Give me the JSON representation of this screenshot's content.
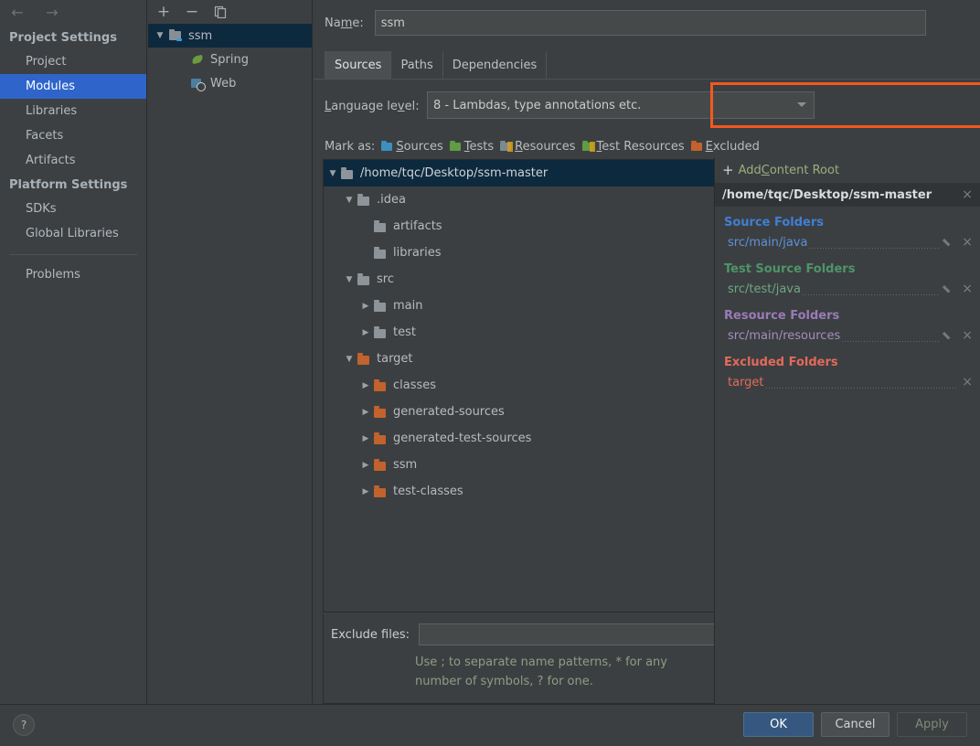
{
  "nav": {
    "back": "←",
    "forward": "→"
  },
  "sidebar": {
    "groups": [
      {
        "title": "Project Settings",
        "items": [
          {
            "label": "Project",
            "selected": false
          },
          {
            "label": "Modules",
            "selected": true
          },
          {
            "label": "Libraries",
            "selected": false
          },
          {
            "label": "Facets",
            "selected": false
          },
          {
            "label": "Artifacts",
            "selected": false
          }
        ]
      },
      {
        "title": "Platform Settings",
        "items": [
          {
            "label": "SDKs",
            "selected": false
          },
          {
            "label": "Global Libraries",
            "selected": false
          }
        ]
      }
    ],
    "problems": "Problems"
  },
  "modules_panel": {
    "toolbar": {
      "add": "+",
      "remove": "−",
      "copy": "copy-icon"
    },
    "tree": [
      {
        "label": "ssm",
        "icon": "module-icon",
        "twisty": "▼",
        "depth": 0,
        "selected": true
      },
      {
        "label": "Spring",
        "icon": "spring-leaf-icon",
        "twisty": "",
        "depth": 1,
        "selected": false
      },
      {
        "label": "Web",
        "icon": "web-icon",
        "twisty": "",
        "depth": 1,
        "selected": false
      }
    ]
  },
  "main": {
    "name_label_a": "Na",
    "name_label_u": "m",
    "name_label_b": "e:",
    "name_value": "ssm",
    "tabs": [
      {
        "label": "Sources",
        "active": true
      },
      {
        "label": "Paths",
        "active": false
      },
      {
        "label": "Dependencies",
        "active": false
      }
    ],
    "language_level": {
      "label_u": "L",
      "label_rest": "anguage le",
      "label_u2": "v",
      "label_end": "el:",
      "value": "8 - Lambdas, type annotations etc.",
      "highlight_color": "#f4581f"
    },
    "mark_as": {
      "label": "Mark as:",
      "options": [
        {
          "icon": "sources-folder-icon",
          "u": "S",
          "rest": "ources",
          "color": "#3d8fbd"
        },
        {
          "icon": "tests-folder-icon",
          "u": "T",
          "rest": "ests",
          "color": "#5f9c44"
        },
        {
          "icon": "resources-folder-icon",
          "u": "R",
          "rest": "esources",
          "color": "#7b8a92"
        },
        {
          "icon": "test-resources-folder-icon",
          "u": "T",
          "rest": "est Resources",
          "color": "#5f9c44"
        },
        {
          "icon": "excluded-folder-icon",
          "u": "E",
          "rest": "xcluded",
          "color": "#c2622c"
        }
      ]
    },
    "file_tree": [
      {
        "label": "/home/tqc/Desktop/ssm-master",
        "twisty": "▼",
        "indent": 0,
        "folder": "grey",
        "selected": true
      },
      {
        "label": ".idea",
        "twisty": "▼",
        "indent": 1,
        "folder": "grey",
        "selected": false
      },
      {
        "label": "artifacts",
        "twisty": "",
        "indent": 2,
        "folder": "grey",
        "selected": false
      },
      {
        "label": "libraries",
        "twisty": "",
        "indent": 2,
        "folder": "grey",
        "selected": false
      },
      {
        "label": "src",
        "twisty": "▼",
        "indent": 1,
        "folder": "grey",
        "selected": false
      },
      {
        "label": "main",
        "twisty": "▶",
        "indent": 2,
        "folder": "grey",
        "selected": false
      },
      {
        "label": "test",
        "twisty": "▶",
        "indent": 2,
        "folder": "grey",
        "selected": false
      },
      {
        "label": "target",
        "twisty": "▼",
        "indent": 1,
        "folder": "orange",
        "selected": false
      },
      {
        "label": "classes",
        "twisty": "▶",
        "indent": 2,
        "folder": "orange",
        "selected": false
      },
      {
        "label": "generated-sources",
        "twisty": "▶",
        "indent": 2,
        "folder": "orange",
        "selected": false
      },
      {
        "label": "generated-test-sources",
        "twisty": "▶",
        "indent": 2,
        "folder": "orange",
        "selected": false
      },
      {
        "label": "ssm",
        "twisty": "▶",
        "indent": 2,
        "folder": "orange",
        "selected": false
      },
      {
        "label": "test-classes",
        "twisty": "▶",
        "indent": 2,
        "folder": "orange",
        "selected": false
      }
    ],
    "exclude_files": {
      "label": "Exclude files:",
      "value": "",
      "placeholder": "",
      "hint": "Use ; to separate name patterns, * for any number of symbols, ? for one."
    }
  },
  "right_panel": {
    "add_content_root": {
      "plus": "+",
      "a": "Add ",
      "u": "C",
      "rest": "ontent Root"
    },
    "root_path": "/home/tqc/Desktop/ssm-master",
    "close": "×",
    "sections": [
      {
        "title": "Source Folders",
        "color": "#3f7fd6",
        "cls": "src",
        "entries": [
          {
            "path": "src/main/java",
            "has_pencil": true,
            "has_close": true
          }
        ]
      },
      {
        "title": "Test Source Folders",
        "color": "#4e9469",
        "cls": "test",
        "entries": [
          {
            "path": "src/test/java",
            "has_pencil": true,
            "has_close": true
          }
        ]
      },
      {
        "title": "Resource Folders",
        "color": "#9a7bb8",
        "cls": "res",
        "entries": [
          {
            "path": "src/main/resources",
            "has_pencil": true,
            "has_close": true
          }
        ]
      },
      {
        "title": "Excluded Folders",
        "color": "#e36a5a",
        "cls": "exc",
        "entries": [
          {
            "path": "target",
            "has_pencil": false,
            "has_close": true
          }
        ]
      }
    ]
  },
  "bottom": {
    "help": "?",
    "ok": "OK",
    "cancel": "Cancel",
    "apply": "Apply"
  }
}
